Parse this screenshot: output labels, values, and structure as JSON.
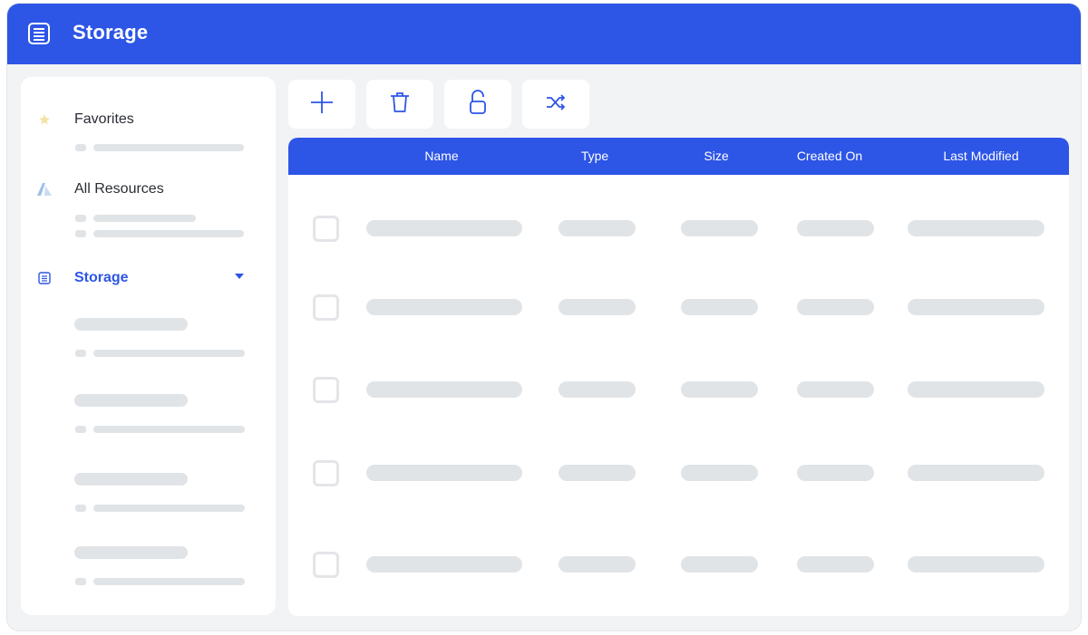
{
  "window": {
    "title": "Storage",
    "accent_color": "#2d55e6",
    "app_icon": "storage-list-icon"
  },
  "sidebar": {
    "items": [
      {
        "label": "Favorites",
        "icon": "star-icon",
        "active": false
      },
      {
        "label": "All Resources",
        "icon": "azure-icon",
        "active": false
      },
      {
        "label": "Storage",
        "icon": "storage-list-icon",
        "active": true,
        "expanded": true
      }
    ]
  },
  "toolbar": {
    "buttons": [
      {
        "name": "add-button",
        "icon": "plus-icon"
      },
      {
        "name": "delete-button",
        "icon": "trash-icon"
      },
      {
        "name": "unlock-button",
        "icon": "unlock-icon"
      },
      {
        "name": "shuffle-button",
        "icon": "shuffle-icon"
      }
    ]
  },
  "table": {
    "columns": [
      "Name",
      "Type",
      "Size",
      "Created On",
      "Last Modified"
    ],
    "row_count": 5
  }
}
